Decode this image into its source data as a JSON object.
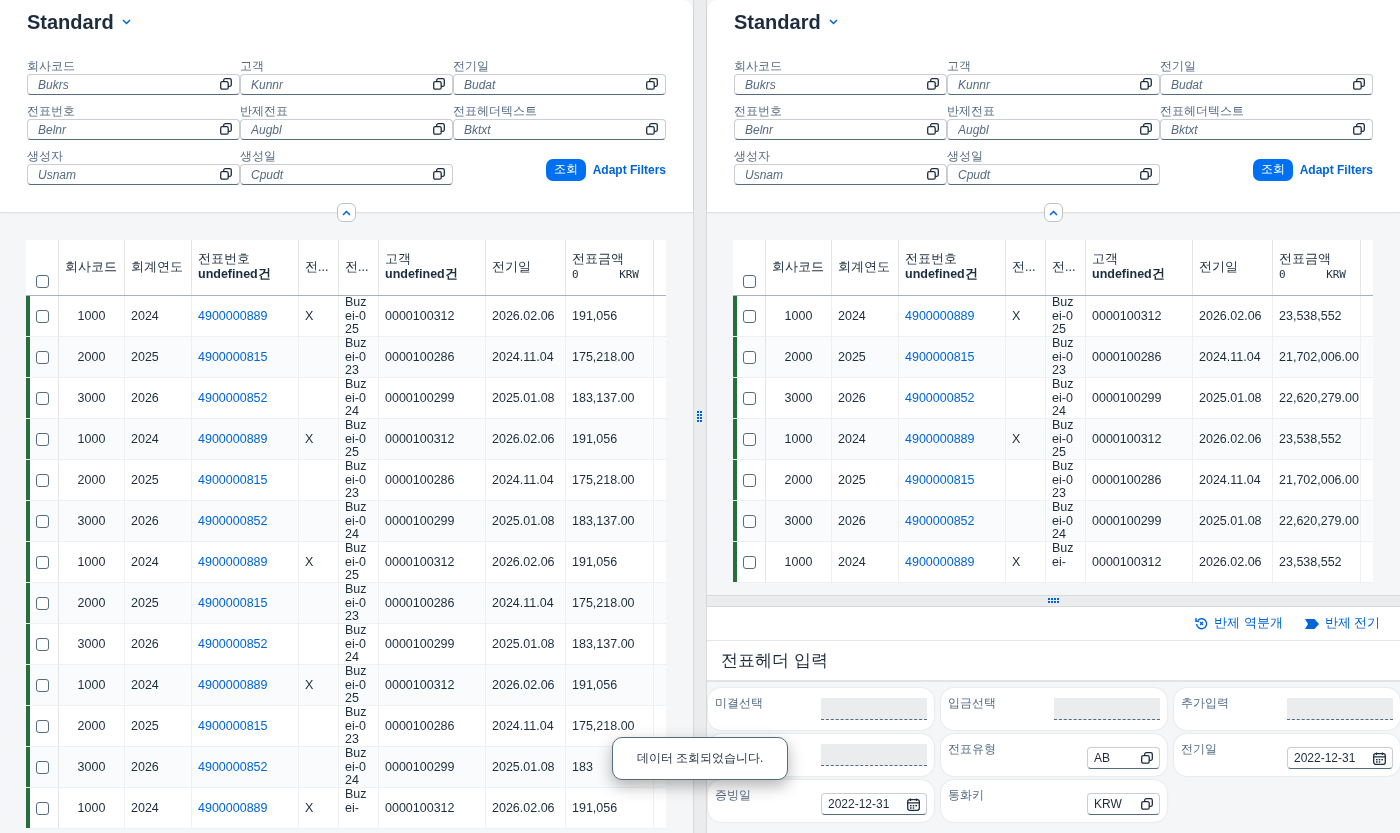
{
  "panes": [
    {
      "variant": {
        "title": "Standard"
      },
      "filters": [
        {
          "label": "회사코드",
          "placeholder": "Bukrs"
        },
        {
          "label": "고객",
          "placeholder": "Kunnr"
        },
        {
          "label": "전기일",
          "placeholder": "Budat"
        },
        {
          "label": "전표번호",
          "placeholder": "Belnr"
        },
        {
          "label": "반제전표",
          "placeholder": "Augbl"
        },
        {
          "label": "전표헤더텍스트",
          "placeholder": "Bktxt"
        },
        {
          "label": "생성자",
          "placeholder": "Usnam"
        },
        {
          "label": "생성일",
          "placeholder": "Cpudt"
        }
      ],
      "go_button": "조회",
      "adapt_link": "Adapt Filters",
      "table": {
        "select_all": {
          "checked": false
        },
        "columns": [
          {
            "label": "회사코드",
            "kind": "center"
          },
          {
            "label": "회계연도",
            "kind": "text"
          },
          {
            "label": "전표번호",
            "count": "undefined건",
            "kind": "link"
          },
          {
            "label": "전...",
            "kind": "text"
          },
          {
            "label": "전...",
            "kind": "wrap"
          },
          {
            "label": "고객",
            "count": "undefined건",
            "kind": "text"
          },
          {
            "label": "전기일",
            "kind": "text"
          },
          {
            "label": "전표금액",
            "total": "0",
            "currency": "KRW",
            "kind": "text"
          }
        ],
        "rows": [
          {
            "highlighted": true,
            "selected": false,
            "cells": [
              "1000",
              "2024",
              "4900000889",
              "X",
              "Buzei-025",
              "0000100312",
              "2026.02.06",
              "191,056"
            ]
          },
          {
            "highlighted": true,
            "selected": false,
            "cells": [
              "2000",
              "2025",
              "4900000815",
              "",
              "Buzei-023",
              "0000100286",
              "2024.11.04",
              "175,218.00"
            ]
          },
          {
            "highlighted": true,
            "selected": false,
            "cells": [
              "3000",
              "2026",
              "4900000852",
              "",
              "Buzei-024",
              "0000100299",
              "2025.01.08",
              "183,137.00"
            ]
          },
          {
            "highlighted": true,
            "selected": false,
            "cells": [
              "1000",
              "2024",
              "4900000889",
              "X",
              "Buzei-025",
              "0000100312",
              "2026.02.06",
              "191,056"
            ]
          },
          {
            "highlighted": true,
            "selected": false,
            "cells": [
              "2000",
              "2025",
              "4900000815",
              "",
              "Buzei-023",
              "0000100286",
              "2024.11.04",
              "175,218.00"
            ]
          },
          {
            "highlighted": true,
            "selected": false,
            "cells": [
              "3000",
              "2026",
              "4900000852",
              "",
              "Buzei-024",
              "0000100299",
              "2025.01.08",
              "183,137.00"
            ]
          },
          {
            "highlighted": true,
            "selected": false,
            "cells": [
              "1000",
              "2024",
              "4900000889",
              "X",
              "Buzei-025",
              "0000100312",
              "2026.02.06",
              "191,056"
            ]
          },
          {
            "highlighted": true,
            "selected": false,
            "cells": [
              "2000",
              "2025",
              "4900000815",
              "",
              "Buzei-023",
              "0000100286",
              "2024.11.04",
              "175,218.00"
            ]
          },
          {
            "highlighted": true,
            "selected": false,
            "cells": [
              "3000",
              "2026",
              "4900000852",
              "",
              "Buzei-024",
              "0000100299",
              "2025.01.08",
              "183,137.00"
            ]
          },
          {
            "highlighted": true,
            "selected": false,
            "cells": [
              "1000",
              "2024",
              "4900000889",
              "X",
              "Buzei-025",
              "0000100312",
              "2026.02.06",
              "191,056"
            ]
          },
          {
            "highlighted": true,
            "selected": false,
            "cells": [
              "2000",
              "2025",
              "4900000815",
              "",
              "Buzei-023",
              "0000100286",
              "2024.11.04",
              "175,218.00"
            ]
          },
          {
            "highlighted": true,
            "selected": false,
            "cells": [
              "3000",
              "2026",
              "4900000852",
              "",
              "Buzei-024",
              "0000100299",
              "2025.01.08",
              "183"
            ]
          },
          {
            "highlighted": true,
            "selected": false,
            "cells": [
              "1000",
              "2024",
              "4900000889",
              "X",
              "Buzei-",
              "0000100312",
              "2026.02.06",
              "191,056"
            ]
          }
        ]
      }
    },
    {
      "variant": {
        "title": "Standard"
      },
      "filters": [
        {
          "label": "회사코드",
          "placeholder": "Bukrs"
        },
        {
          "label": "고객",
          "placeholder": "Kunnr"
        },
        {
          "label": "전기일",
          "placeholder": "Budat"
        },
        {
          "label": "전표번호",
          "placeholder": "Belnr"
        },
        {
          "label": "반제전표",
          "placeholder": "Augbl"
        },
        {
          "label": "전표헤더텍스트",
          "placeholder": "Bktxt"
        },
        {
          "label": "생성자",
          "placeholder": "Usnam"
        },
        {
          "label": "생성일",
          "placeholder": "Cpudt"
        }
      ],
      "go_button": "조회",
      "adapt_link": "Adapt Filters",
      "table": {
        "select_all": {
          "checked": false
        },
        "columns": [
          {
            "label": "회사코드",
            "kind": "center"
          },
          {
            "label": "회계연도",
            "kind": "text"
          },
          {
            "label": "전표번호",
            "count": "undefined건",
            "kind": "link"
          },
          {
            "label": "전...",
            "kind": "text"
          },
          {
            "label": "전...",
            "kind": "wrap"
          },
          {
            "label": "고객",
            "count": "undefined건",
            "kind": "text"
          },
          {
            "label": "전기일",
            "kind": "text"
          },
          {
            "label": "전표금액",
            "total": "0",
            "currency": "KRW",
            "kind": "text"
          }
        ],
        "rows": [
          {
            "highlighted": true,
            "selected": false,
            "cells": [
              "1000",
              "2024",
              "4900000889",
              "X",
              "Buzei-025",
              "0000100312",
              "2026.02.06",
              "23,538,552"
            ]
          },
          {
            "highlighted": true,
            "selected": false,
            "cells": [
              "2000",
              "2025",
              "4900000815",
              "",
              "Buzei-023",
              "0000100286",
              "2024.11.04",
              "21,702,006.00"
            ]
          },
          {
            "highlighted": true,
            "selected": false,
            "cells": [
              "3000",
              "2026",
              "4900000852",
              "",
              "Buzei-024",
              "0000100299",
              "2025.01.08",
              "22,620,279.00"
            ]
          },
          {
            "highlighted": true,
            "selected": false,
            "cells": [
              "1000",
              "2024",
              "4900000889",
              "X",
              "Buzei-025",
              "0000100312",
              "2026.02.06",
              "23,538,552"
            ]
          },
          {
            "highlighted": true,
            "selected": false,
            "cells": [
              "2000",
              "2025",
              "4900000815",
              "",
              "Buzei-023",
              "0000100286",
              "2024.11.04",
              "21,702,006.00"
            ]
          },
          {
            "highlighted": true,
            "selected": false,
            "cells": [
              "3000",
              "2026",
              "4900000852",
              "",
              "Buzei-024",
              "0000100299",
              "2025.01.08",
              "22,620,279.00"
            ]
          },
          {
            "highlighted": true,
            "selected": false,
            "cells": [
              "1000",
              "2024",
              "4900000889",
              "X",
              "Buzei-",
              "0000100312",
              "2026.02.06",
              "23,538,552"
            ]
          }
        ]
      }
    }
  ],
  "actions": [
    {
      "kind": "reverse",
      "label": "반제 역분개"
    },
    {
      "kind": "post",
      "label": "반제 전기"
    }
  ],
  "form": {
    "title": "전표헤더 입력",
    "fields": [
      {
        "label": "미결선택",
        "kind": "blank"
      },
      {
        "label": "입금선택",
        "kind": "blank"
      },
      {
        "label": "추가입력",
        "kind": "blank"
      },
      {
        "kind": "blank"
      },
      {
        "label": "전표유형",
        "kind": "value_help",
        "value": "AB"
      },
      {
        "label": "전기일",
        "kind": "date",
        "value": "2022-12-31"
      },
      {
        "label": "증빙일",
        "kind": "date",
        "value": "2022-12-31"
      },
      {
        "label": "통화키",
        "kind": "value_help",
        "value": "KRW"
      }
    ]
  },
  "toast": "데이터 조회되었습니다."
}
